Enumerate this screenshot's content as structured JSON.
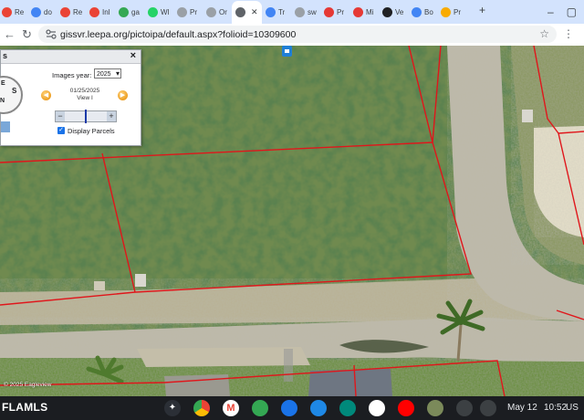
{
  "browser": {
    "tabs": [
      {
        "label": "Re",
        "icon": "gmail-icon",
        "color": "#ea4335"
      },
      {
        "label": "do",
        "icon": "docs-icon",
        "color": "#4285f4"
      },
      {
        "label": "Re",
        "icon": "gmail-icon",
        "color": "#ea4335"
      },
      {
        "label": "Inl",
        "icon": "gmail-icon",
        "color": "#ea4335"
      },
      {
        "label": "ga",
        "icon": "sheets-icon",
        "color": "#34a853"
      },
      {
        "label": "Wl",
        "icon": "whatsapp-icon",
        "color": "#25d366"
      },
      {
        "label": "Pr",
        "icon": "globe-icon",
        "color": "#9aa0a6"
      },
      {
        "label": "Or",
        "icon": "globe-icon",
        "color": "#9aa0a6"
      },
      {
        "label": "",
        "icon": "globe-icon",
        "color": "#5f6368",
        "active": true,
        "close": "✕"
      },
      {
        "label": "Tr",
        "icon": "docs-icon",
        "color": "#4285f4"
      },
      {
        "label": "sw",
        "icon": "globe-icon",
        "color": "#9aa0a6"
      },
      {
        "label": "Pr",
        "icon": "red-icon",
        "color": "#e53935"
      },
      {
        "label": "Mi",
        "icon": "red-icon",
        "color": "#e53935"
      },
      {
        "label": "Ve",
        "icon": "dark-icon",
        "color": "#202124"
      },
      {
        "label": "Bo",
        "icon": "blue-icon",
        "color": "#4285f4"
      },
      {
        "label": "Pr",
        "icon": "yellow-icon",
        "color": "#f9ab00"
      }
    ],
    "new_tab": "+",
    "url": "gissvr.leepa.org/pictoipa/default.aspx?folioid=10309600"
  },
  "panel": {
    "title": "s",
    "close": "×",
    "images_year_label": "Images year:",
    "images_year_value": "2025",
    "image_date": "01/25/2025",
    "image_view": "View I",
    "display_parcels_label": "Display Parcels",
    "display_parcels_checked": true,
    "zoom_level": 0.5
  },
  "map": {
    "copyright": "© 2025 Eagleview"
  },
  "taskbar": {
    "watermark": "FLAMLS",
    "date": "May 12",
    "time": "10:52",
    "locale": "US"
  },
  "colors": {
    "tab_strip": "#d3e3fd",
    "parcel_lines": "#e0161b",
    "taskbar": "#1b1d21"
  }
}
